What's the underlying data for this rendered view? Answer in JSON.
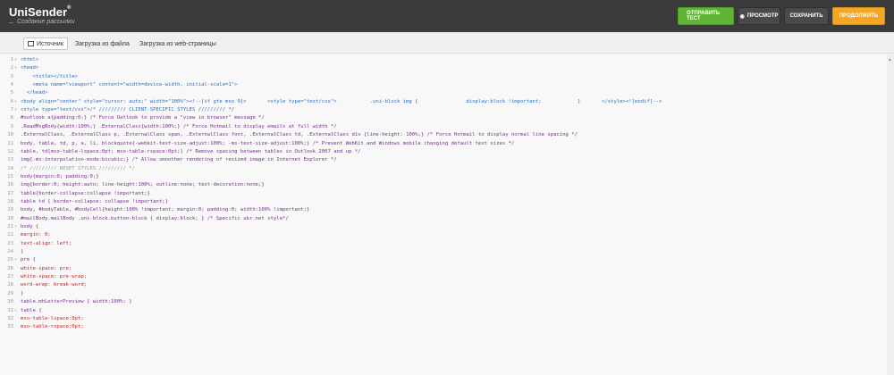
{
  "header": {
    "logo": "UniSender",
    "logo_mark": "®",
    "back_label": "Создание рассылки",
    "buttons": {
      "test": "ОТПРАВИТЬ ТЕСТ",
      "preview": "ПРОСМОТР",
      "save": "СОХРАНИТЬ",
      "continue": "ПРОДОЛЖИТЬ"
    }
  },
  "tabs": [
    {
      "label": "Источник",
      "active": true
    },
    {
      "label": "Загрузка из файла",
      "active": false
    },
    {
      "label": "Загрузка из web-страницы",
      "active": false
    }
  ],
  "editor": {
    "lines": [
      {
        "n": "1",
        "fold": "▾",
        "text": "<html>"
      },
      {
        "n": "2",
        "fold": "▾",
        "text": "<head>"
      },
      {
        "n": "3",
        "fold": "",
        "text": "    <title></title>"
      },
      {
        "n": "4",
        "fold": "",
        "text": "    <meta name=\"viewport\" content=\"width=device-width, initial-scale=1\">"
      },
      {
        "n": "5",
        "fold": "",
        "text": "  </head>"
      },
      {
        "n": "6",
        "fold": "▾",
        "text": "<body align=\"center\" style=\"cursor: auto;\" width=\"100%\"><!--[if gte mso 9]>       <style type=\"text/css\">           .uni-block img {                display:block !important;            }       </style><![endif]-->"
      },
      {
        "n": "7",
        "fold": "▾",
        "text": "<style type=\"text/css\">/* ///////// CLIENT-SPECIFIC STYLES ///////// */"
      },
      {
        "n": "8",
        "fold": "",
        "text": "#outlook a{padding:0;} /* Force Outlook to provide a \"view in browser\" message */"
      },
      {
        "n": "9",
        "fold": "",
        "text": ".ReadMsgBody{width:100%;} .ExternalClass{width:100%;} /* Force Hotmail to display emails at full width */"
      },
      {
        "n": "10",
        "fold": "",
        "text": ".ExternalClass, .ExternalClass p, .ExternalClass span, .ExternalClass font, .ExternalClass td, .ExternalClass div {line-height: 100%;} /* Force Hotmail to display normal line spacing */"
      },
      {
        "n": "11",
        "fold": "",
        "text": "body, table, td, p, a, li, blockquote{-webkit-text-size-adjust:100%; -ms-text-size-adjust:100%;} /* Prevent WebKit and Windows mobile changing default text sizes */"
      },
      {
        "n": "12",
        "fold": "",
        "text": "table, td{mso-table-lspace:0pt; mso-table-rspace:0pt;} /* Remove spacing between tables in Outlook 2007 and up */"
      },
      {
        "n": "13",
        "fold": "",
        "text": "img{-ms-interpolation-mode:bicubic;} /* Allow smoother rendering of resized image in Internet Explorer */"
      },
      {
        "n": "14",
        "fold": "",
        "text": "/* ///////// RESET STYLES ///////// */"
      },
      {
        "n": "15",
        "fold": "",
        "text": "body{margin:0; padding:0;}"
      },
      {
        "n": "16",
        "fold": "",
        "text": "img{border:0; height:auto; line-height:100%; outline:none; text-decoration:none;}"
      },
      {
        "n": "17",
        "fold": "",
        "text": "table{border-collapse:collapse !important;}"
      },
      {
        "n": "18",
        "fold": "",
        "text": "table td { border-collapse: collapse !important;}"
      },
      {
        "n": "19",
        "fold": "",
        "text": "body, #bodyTable, #bodyCell{height:100% !important; margin:0; padding:0; width:100% !important;}"
      },
      {
        "n": "20",
        "fold": "",
        "text": "#mailBody.mailBody .uni-block.button-block { display:block; } /* Specific ukr.net style*/"
      },
      {
        "n": "21",
        "fold": "▾",
        "text": "body {"
      },
      {
        "n": "22",
        "fold": "",
        "text": "margin: 0;"
      },
      {
        "n": "23",
        "fold": "",
        "text": "text-align: left;"
      },
      {
        "n": "24",
        "fold": "",
        "text": "}"
      },
      {
        "n": "25",
        "fold": "▾",
        "text": "pre {"
      },
      {
        "n": "26",
        "fold": "",
        "text": "white-space: pre;"
      },
      {
        "n": "27",
        "fold": "",
        "text": "white-space: pre-wrap;"
      },
      {
        "n": "28",
        "fold": "",
        "text": "word-wrap: break-word;"
      },
      {
        "n": "29",
        "fold": "",
        "text": "}"
      },
      {
        "n": "30",
        "fold": "",
        "text": "table.mhLetterPreview { width:100%; }"
      },
      {
        "n": "31",
        "fold": "▾",
        "text": "table {"
      },
      {
        "n": "32",
        "fold": "",
        "text": "mso-table-lspace:0pt;"
      },
      {
        "n": "33",
        "fold": "",
        "text": "mso-table-rspace:0pt;"
      }
    ]
  }
}
